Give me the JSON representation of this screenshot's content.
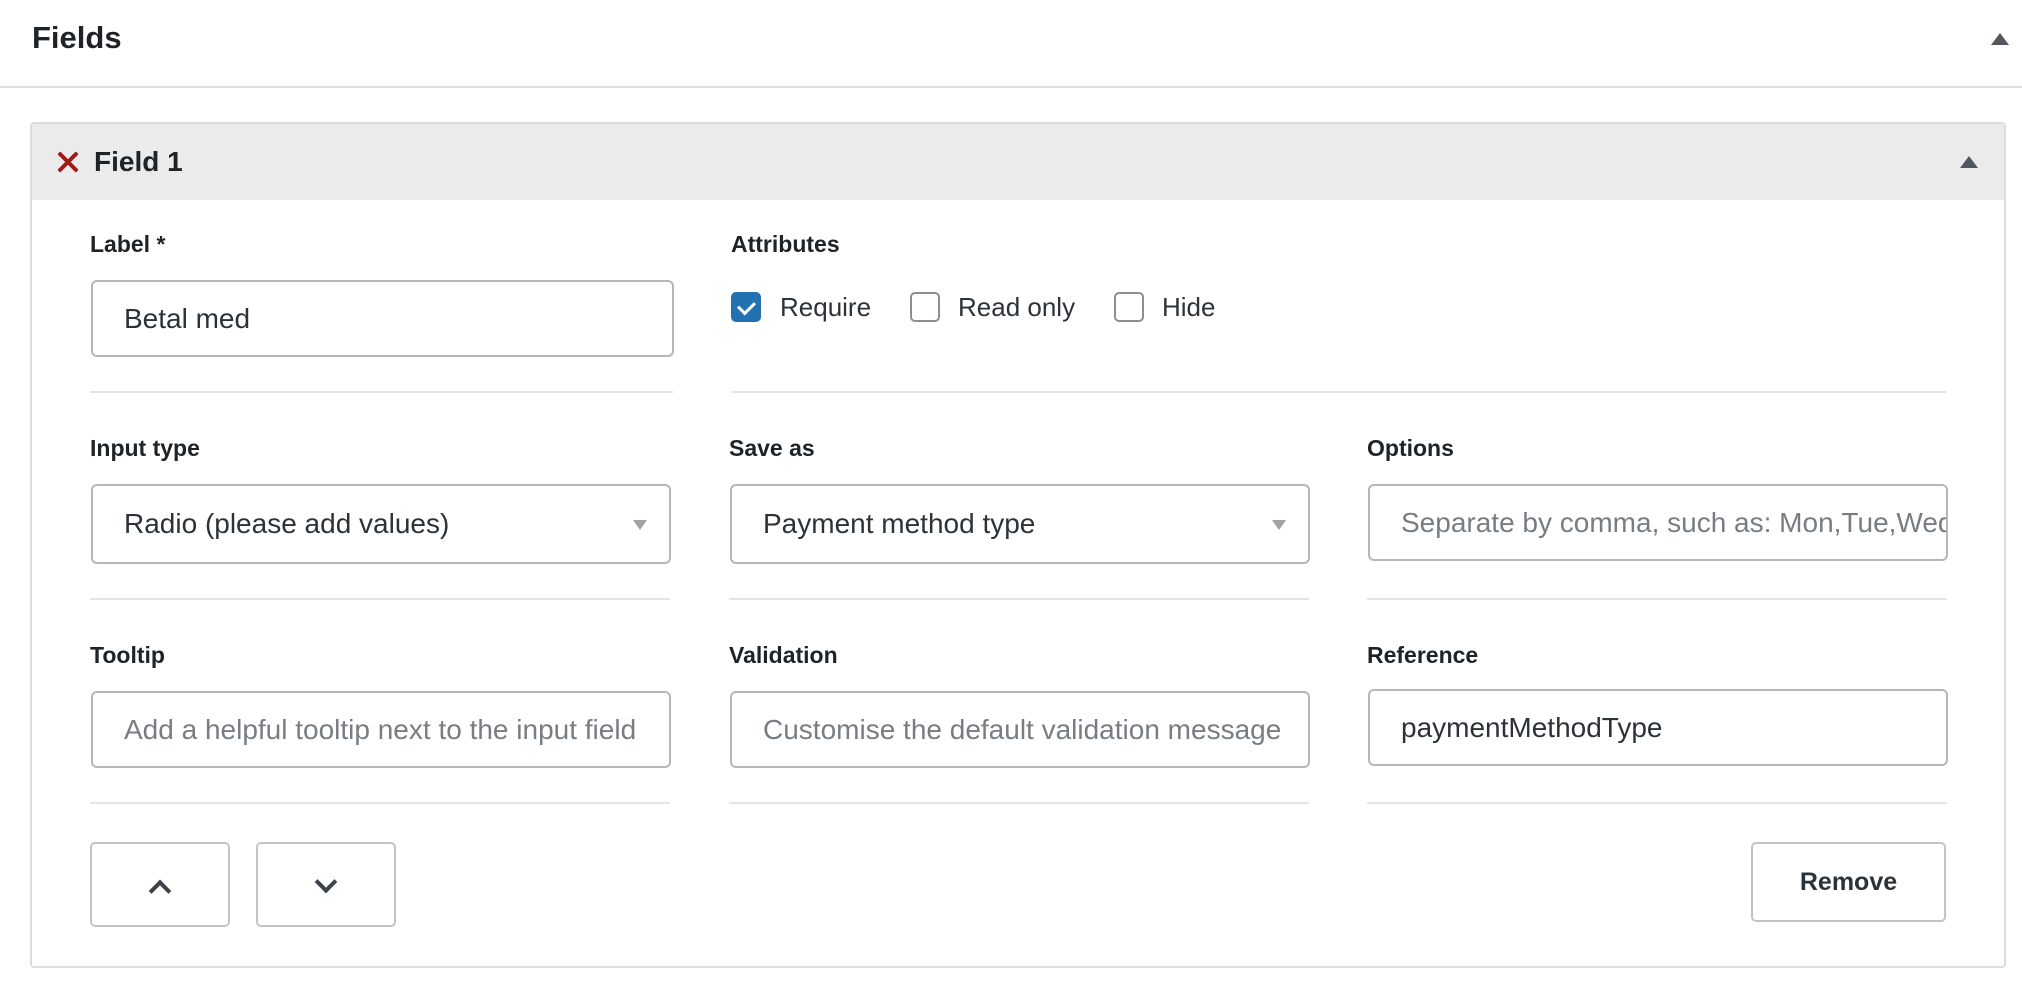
{
  "section": {
    "title": "Fields",
    "collapse_icon": "triangle-up-icon"
  },
  "field": {
    "title": "Field 1",
    "remove_icon": "close-icon",
    "collapse_icon": "triangle-up-icon",
    "label": {
      "label": "Label *",
      "value": "Betal med"
    },
    "attributes": {
      "label": "Attributes",
      "options": [
        {
          "label": "Require",
          "checked": true
        },
        {
          "label": "Read only",
          "checked": false
        },
        {
          "label": "Hide",
          "checked": false
        }
      ]
    },
    "input_type": {
      "label": "Input type",
      "value": "Radio (please add values)"
    },
    "save_as": {
      "label": "Save as",
      "value": "Payment method type"
    },
    "options": {
      "label": "Options",
      "placeholder": "Separate by comma, such as: Mon,Tue,Wed"
    },
    "tooltip": {
      "label": "Tooltip",
      "placeholder": "Add a helpful tooltip next to the input field"
    },
    "validation": {
      "label": "Validation",
      "placeholder": "Customise the default validation message"
    },
    "reference": {
      "label": "Reference",
      "value": "paymentMethodType"
    },
    "move_up_icon": "chevron-up-icon",
    "move_down_icon": "chevron-down-icon",
    "remove_button": "Remove"
  },
  "colors": {
    "accent": "#2271b1",
    "remove_x": "#a11a1a",
    "header_bg": "#ebebeb"
  }
}
